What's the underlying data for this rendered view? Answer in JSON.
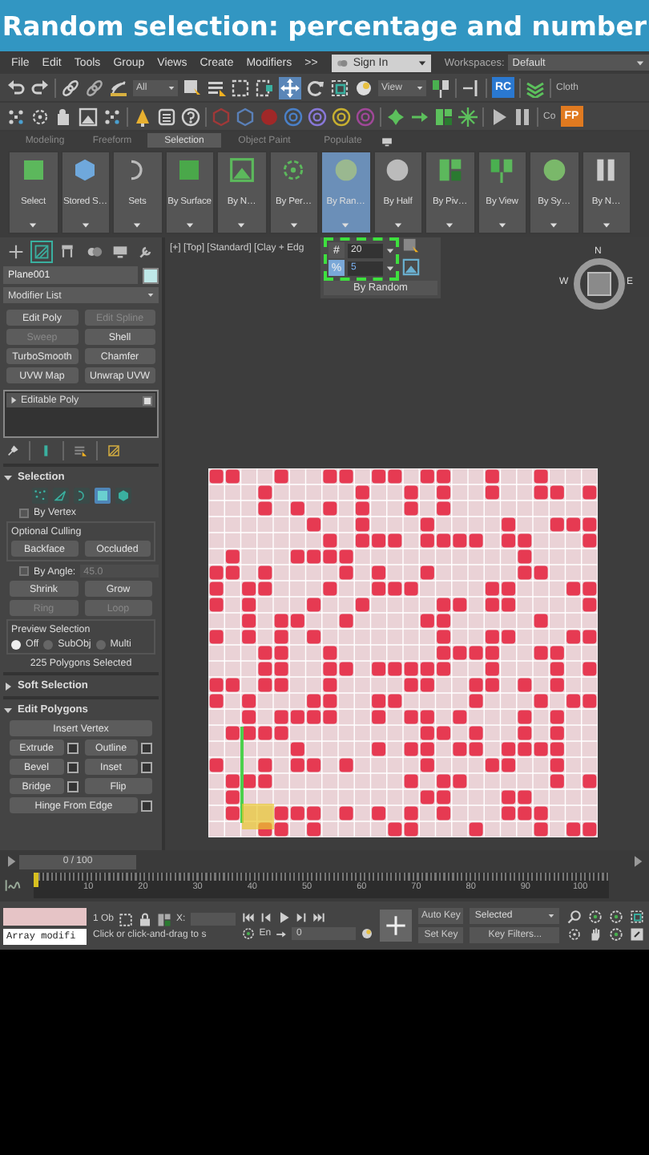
{
  "banner": {
    "title": "Random selection: percentage and number"
  },
  "menu": {
    "items": [
      "File",
      "Edit",
      "Tools",
      "Group",
      "Views",
      "Create",
      "Modifiers",
      ">>"
    ],
    "sign_in": "Sign In",
    "workspaces_label": "Workspaces:",
    "workspace": "Default"
  },
  "main_toolbar": {
    "filter": "All",
    "coordinate_system": "View",
    "badge": "RC",
    "tail_label": "Cloth"
  },
  "secondary_toolbar": {
    "tail_label": "Co",
    "badge": "FP"
  },
  "ribbon": {
    "tabs": [
      {
        "label": "Modeling",
        "selected": false
      },
      {
        "label": "Freeform",
        "selected": false
      },
      {
        "label": "Selection",
        "selected": true
      },
      {
        "label": "Object Paint",
        "selected": false
      },
      {
        "label": "Populate",
        "selected": false
      }
    ],
    "buttons": [
      {
        "label": "Select",
        "selected": false
      },
      {
        "label": "Stored S…",
        "selected": false
      },
      {
        "label": "Sets",
        "selected": false
      },
      {
        "label": "By Surface",
        "selected": false
      },
      {
        "label": "By N…",
        "selected": false
      },
      {
        "label": "By Per…",
        "selected": false
      },
      {
        "label": "By Ran…",
        "selected": true
      },
      {
        "label": "By Half",
        "selected": false
      },
      {
        "label": "By Piv…",
        "selected": false
      },
      {
        "label": "By View",
        "selected": false
      },
      {
        "label": "By Sy…",
        "selected": false
      },
      {
        "label": "By N…",
        "selected": false
      }
    ]
  },
  "random_popup": {
    "modes": [
      {
        "symbol": "#",
        "value": "20",
        "selected": false
      },
      {
        "symbol": "%",
        "value": "5",
        "selected": true
      }
    ],
    "title": "By Random"
  },
  "viewport": {
    "label": "[+] [Top] [Standard] [Clay + Edg",
    "compass": [
      "N",
      "W",
      "E"
    ]
  },
  "command_panel": {
    "tabs": [
      {
        "selected": false
      },
      {
        "selected": true
      },
      {
        "selected": false
      },
      {
        "selected": false
      },
      {
        "selected": false
      },
      {
        "selected": false
      }
    ],
    "object_name": "Plane001",
    "modifier_list": "Modifier List",
    "modifiers": [
      {
        "label": "Edit Poly",
        "disabled": false
      },
      {
        "label": "Edit Spline",
        "disabled": true
      },
      {
        "label": "Sweep",
        "disabled": true
      },
      {
        "label": "Shell",
        "disabled": false
      },
      {
        "label": "TurboSmooth",
        "disabled": false
      },
      {
        "label": "Chamfer",
        "disabled": false
      },
      {
        "label": "UVW Map",
        "disabled": false
      },
      {
        "label": "Unwrap UVW",
        "disabled": false
      }
    ],
    "stack": [
      {
        "label": "Editable Poly"
      }
    ]
  },
  "selection": {
    "title": "Selection",
    "expanded": true,
    "levels": [
      {
        "selected": false
      },
      {
        "selected": false
      },
      {
        "selected": false
      },
      {
        "selected": true
      },
      {
        "selected": false
      }
    ],
    "by_vertex": {
      "label": "By Vertex",
      "checked": false
    },
    "culling_label": "Optional Culling",
    "culling": [
      "Backface",
      "Occluded"
    ],
    "by_angle": {
      "label": "By Angle:",
      "checked": false,
      "value": "45.0"
    },
    "grow": [
      {
        "label": "Shrink",
        "disabled": false
      },
      {
        "label": "Grow",
        "disabled": false
      },
      {
        "label": "Ring",
        "disabled": true
      },
      {
        "label": "Loop",
        "disabled": true
      }
    ],
    "preview_label": "Preview Selection",
    "preview": [
      {
        "label": "Off",
        "selected": true
      },
      {
        "label": "SubObj",
        "selected": false
      },
      {
        "label": "Multi",
        "selected": false
      }
    ],
    "status": "225 Polygons Selected"
  },
  "soft_selection": {
    "title": "Soft Selection",
    "expanded": false
  },
  "edit_polygons": {
    "title": "Edit Polygons",
    "expanded": true,
    "buttons": [
      {
        "label": "Insert Vertex",
        "settings": false,
        "wide": true
      },
      {
        "label": "Extrude",
        "settings": true,
        "wide": false
      },
      {
        "label": "Outline",
        "settings": true,
        "wide": false
      },
      {
        "label": "Bevel",
        "settings": true,
        "wide": false
      },
      {
        "label": "Inset",
        "settings": true,
        "wide": false
      },
      {
        "label": "Bridge",
        "settings": true,
        "wide": false
      },
      {
        "label": "Flip",
        "settings": false,
        "wide": false
      },
      {
        "label": "Hinge From Edge",
        "settings": true,
        "wide": true
      }
    ]
  },
  "timeline": {
    "frame": "0 / 100",
    "level": 0,
    "ticks": [
      "10",
      "20",
      "30",
      "40",
      "50",
      "60",
      "70",
      "80",
      "90",
      "100"
    ]
  },
  "status_bar": {
    "modifier_field": "Array modifi",
    "selection_count": "1 Ob",
    "x_label": "X:",
    "prompt": "Click or click-and-drag to s",
    "snap_label": "En",
    "frame_value": "0",
    "auto_key": "Auto Key",
    "key_mode": "Selected",
    "set_key": "Set Key",
    "key_filters": "Key Filters..."
  }
}
